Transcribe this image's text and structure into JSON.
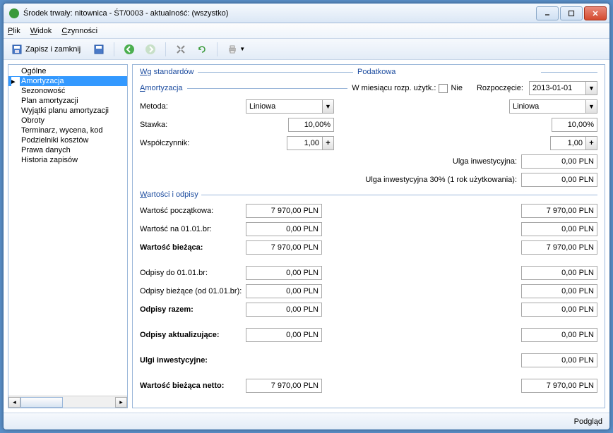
{
  "window": {
    "title": "Środek trwały: nitownica - ŚT/0003 - aktualność: (wszystko)"
  },
  "menu": {
    "file": "Plik",
    "view": "Widok",
    "actions": "Czynności"
  },
  "toolbar": {
    "save_close": "Zapisz i zamknij"
  },
  "nav": {
    "items": [
      "Ogólne",
      "Amortyzacja",
      "Sezonowość",
      "Plan amortyzacji",
      "Wyjątki planu amortyzacji",
      "Obroty",
      "Terminarz, wycena, kod",
      "Podzielniki kosztów",
      "Prawa danych",
      "Historia zapisów"
    ],
    "selected_index": 1
  },
  "headers": {
    "standards": "Wg standardów",
    "tax": "Podatkowa",
    "amort": "Amortyzacja",
    "values": "Wartości i odpisy"
  },
  "amort": {
    "start_month_lbl": "W miesiącu rozp. użytk.:",
    "start_month_chk": "Nie",
    "start_lbl": "Rozpoczęcie:",
    "start_date": "2013-01-01",
    "method_lbl": "Metoda:",
    "method1": "Liniowa",
    "method2": "Liniowa",
    "rate_lbl": "Stawka:",
    "rate1": "10,00%",
    "rate2": "10,00%",
    "coef_lbl": "Współczynnik:",
    "coef1": "1,00",
    "coef2": "1,00",
    "ulga_lbl": "Ulga inwestycyjna:",
    "ulga_val": "0,00 PLN",
    "ulga30_lbl": "Ulga inwestycyjna 30% (1 rok użytkowania):",
    "ulga30_val": "0,00 PLN"
  },
  "vals": {
    "initial_lbl": "Wartość początkowa:",
    "initial1": "7 970,00 PLN",
    "initial2": "7 970,00 PLN",
    "on0101_lbl": "Wartość na 01.01.br:",
    "on0101_1": "0,00 PLN",
    "on0101_2": "0,00 PLN",
    "current_lbl": "Wartość bieżąca:",
    "current1": "7 970,00 PLN",
    "current2": "7 970,00 PLN",
    "writeoffs_to_lbl": "Odpisy do 01.01.br:",
    "writeoffs_to1": "0,00 PLN",
    "writeoffs_to2": "0,00 PLN",
    "writeoffs_cur_lbl": "Odpisy bieżące (od 01.01.br):",
    "writeoffs_cur1": "0,00 PLN",
    "writeoffs_cur2": "0,00 PLN",
    "writeoffs_sum_lbl": "Odpisy razem:",
    "writeoffs_sum1": "0,00 PLN",
    "writeoffs_sum2": "0,00 PLN",
    "writeoffs_upd_lbl": "Odpisy aktualizujące:",
    "writeoffs_upd1": "0,00 PLN",
    "writeoffs_upd2": "0,00 PLN",
    "invest_lbl": "Ulgi inwestycyjne:",
    "invest2": "0,00 PLN",
    "net_lbl": "Wartość bieżąca netto:",
    "net1": "7 970,00 PLN",
    "net2": "7 970,00 PLN"
  },
  "footer": {
    "preview": "Podgląd"
  }
}
